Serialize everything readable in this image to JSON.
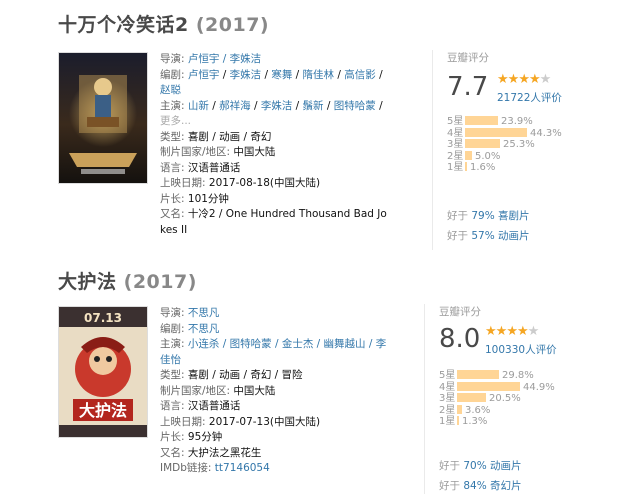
{
  "colors": {
    "link": "#3377aa",
    "star": "#f5a623",
    "bar": "#ffd596"
  },
  "movies": [
    {
      "title": "十万个冷笑话2",
      "year": "(2017)",
      "director_label": "导演:",
      "director": "卢恒宇 / 李姝洁",
      "writer_label": "编剧:",
      "writers": [
        "卢恒宇",
        "李姝洁",
        "寒舞",
        "隋佳林",
        "高信影",
        "赵聪"
      ],
      "cast_label": "主演:",
      "cast": [
        "山新",
        "郝祥海",
        "李姝洁",
        "鬚新",
        "图特哈蒙"
      ],
      "more": "更多...",
      "genre_label": "类型:",
      "genres": [
        "喜剧",
        "动画",
        "奇幻"
      ],
      "country_label": "制片国家/地区:",
      "country": "中国大陆",
      "lang_label": "语言:",
      "lang": "汉语普通话",
      "release_label": "上映日期:",
      "release": "2017-08-18(中国大陆)",
      "runtime_label": "片长:",
      "runtime": "101分钟",
      "aka_label": "又名:",
      "aka_line1": "十冷2 / One Hundred Thousand Bad Jo",
      "aka_line2": "kes II",
      "rating_head": "豆瓣评分",
      "score": "7.7",
      "stars": 4,
      "votes": "21722人评价",
      "dist": [
        {
          "label": "5星",
          "pct": "23.9%",
          "value": 23.9
        },
        {
          "label": "4星",
          "pct": "44.3%",
          "value": 44.3
        },
        {
          "label": "3星",
          "pct": "25.3%",
          "value": 25.3
        },
        {
          "label": "2星",
          "pct": "5.0%",
          "value": 5.0
        },
        {
          "label": "1星",
          "pct": "1.6%",
          "value": 1.6
        }
      ],
      "better": [
        {
          "prefix": "好于 ",
          "link": "79% 喜剧片"
        },
        {
          "prefix": "好于 ",
          "link": "57% 动画片"
        }
      ]
    },
    {
      "title": "大护法",
      "year": "(2017)",
      "director_label": "导演:",
      "director": "不思凡",
      "writer_label": "编剧:",
      "writer": "不思凡",
      "cast_label": "主演:",
      "cast": [
        "小连杀",
        "图特哈蒙",
        "金士杰",
        "幽舞越山",
        "李佳怡"
      ],
      "cast_line1": "小连杀 / 图特哈蒙 / 金士杰 / 幽舞越山 / 李",
      "cast_line2": "佳怡",
      "more": "更多...",
      "genre_label": "类型:",
      "genres": [
        "喜剧",
        "动画",
        "奇幻",
        "冒险"
      ],
      "country_label": "制片国家/地区:",
      "country": "中国大陆",
      "lang_label": "语言:",
      "lang": "汉语普通话",
      "release_label": "上映日期:",
      "release": "2017-07-13(中国大陆)",
      "runtime_label": "片长:",
      "runtime": "95分钟",
      "aka_label": "又名:",
      "aka": "大护法之黑花生",
      "imdb_label": "IMDb链接:",
      "imdb": "tt7146054",
      "rating_head": "豆瓣评分",
      "score": "8.0",
      "stars": 4,
      "votes": "100330人评价",
      "dist": [
        {
          "label": "5星",
          "pct": "29.8%",
          "value": 29.8
        },
        {
          "label": "4星",
          "pct": "44.9%",
          "value": 44.9
        },
        {
          "label": "3星",
          "pct": "20.5%",
          "value": 20.5
        },
        {
          "label": "2星",
          "pct": "3.6%",
          "value": 3.6
        },
        {
          "label": "1星",
          "pct": "1.3%",
          "value": 1.3
        }
      ],
      "better": [
        {
          "prefix": "好于 ",
          "link": "70% 动画片"
        },
        {
          "prefix": "好于 ",
          "link": "84% 奇幻片"
        }
      ]
    }
  ]
}
